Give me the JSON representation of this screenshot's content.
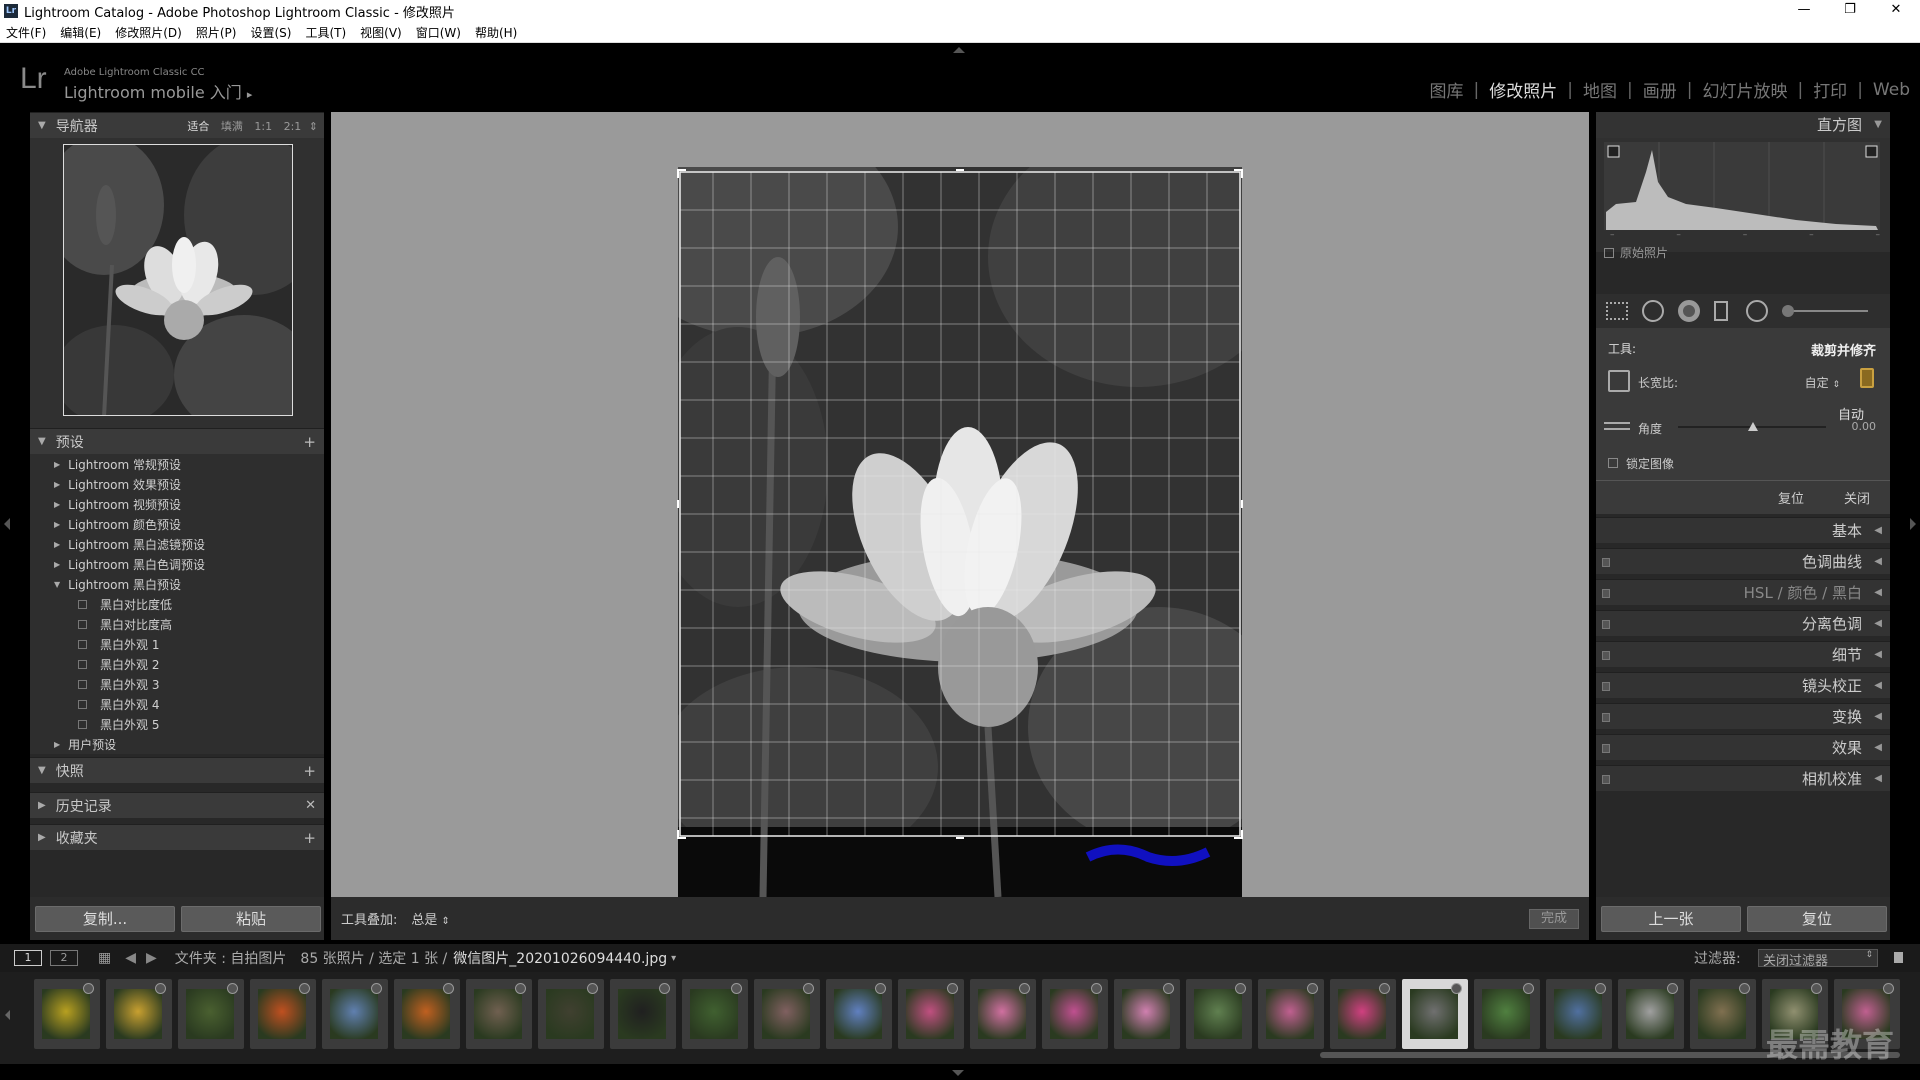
{
  "window": {
    "title": "Lightroom Catalog - Adobe Photoshop Lightroom Classic - 修改照片",
    "badge": "Lr",
    "minimize": "—",
    "maximize": "❐",
    "close": "✕"
  },
  "menu": [
    "文件(F)",
    "编辑(E)",
    "修改照片(D)",
    "照片(P)",
    "设置(S)",
    "工具(T)",
    "视图(V)",
    "窗口(W)",
    "帮助(H)"
  ],
  "identity": {
    "logo": "Lr",
    "product": "Adobe Lightroom Classic CC",
    "mobile": "Lightroom mobile 入门",
    "mobile_arrow": "▸"
  },
  "modules": [
    "图库",
    "修改照片",
    "地图",
    "画册",
    "幻灯片放映",
    "打印",
    "Web"
  ],
  "modules_sep": "|",
  "active_module": "修改照片",
  "navigator": {
    "title": "导航器",
    "options": [
      "适合",
      "填满",
      "1:1",
      "2:1"
    ],
    "options_arrow": "⇕",
    "selected_option": "适合"
  },
  "presets": {
    "title": "预设",
    "items": [
      {
        "label": "Lightroom 常规预设",
        "level": 0,
        "expanded": false
      },
      {
        "label": "Lightroom 效果预设",
        "level": 0,
        "expanded": false
      },
      {
        "label": "Lightroom 视频预设",
        "level": 0,
        "expanded": false
      },
      {
        "label": "Lightroom 颜色预设",
        "level": 0,
        "expanded": false
      },
      {
        "label": "Lightroom 黑白滤镜预设",
        "level": 0,
        "expanded": false
      },
      {
        "label": "Lightroom 黑白色调预设",
        "level": 0,
        "expanded": false
      },
      {
        "label": "Lightroom 黑白预设",
        "level": 0,
        "expanded": true
      },
      {
        "label": "黑白对比度低",
        "level": 1
      },
      {
        "label": "黑白对比度高",
        "level": 1
      },
      {
        "label": "黑白外观 1",
        "level": 1
      },
      {
        "label": "黑白外观 2",
        "level": 1
      },
      {
        "label": "黑白外观 3",
        "level": 1
      },
      {
        "label": "黑白外观 4",
        "level": 1
      },
      {
        "label": "黑白外观 5",
        "level": 1
      },
      {
        "label": "用户预设",
        "level": 0,
        "expanded": false
      }
    ]
  },
  "snapshots": {
    "title": "快照"
  },
  "history": {
    "title": "历史记录"
  },
  "collections": {
    "title": "收藏夹"
  },
  "left_buttons": {
    "copy": "复制...",
    "paste": "粘贴"
  },
  "toolbar": {
    "overlay_label": "工具叠加:",
    "overlay_value": "总是",
    "overlay_arrow": "⇕",
    "done": "完成"
  },
  "histogram": {
    "title": "直方图",
    "original_photo": "原始照片",
    "ticks": [
      "–",
      "–",
      "–",
      "–",
      "–"
    ]
  },
  "crop": {
    "tool_label": "工具:",
    "tool_name": "裁剪并修齐",
    "aspect_label": "长宽比:",
    "aspect_value": "自定",
    "aspect_arrow": "⇕",
    "auto": "自动",
    "angle_label": "角度",
    "angle_value": "0.00",
    "constrain": "锁定图像",
    "reset": "复位",
    "close": "关闭"
  },
  "right_sections": [
    {
      "label": "基本",
      "switch": false
    },
    {
      "label": "色调曲线",
      "switch": true
    },
    {
      "label": "HSL / 颜色 / 黑白",
      "switch": true
    },
    {
      "label": "分离色调",
      "switch": true
    },
    {
      "label": "细节",
      "switch": true
    },
    {
      "label": "镜头校正",
      "switch": true
    },
    {
      "label": "变换",
      "switch": true
    },
    {
      "label": "效果",
      "switch": true
    },
    {
      "label": "相机校准",
      "switch": true
    }
  ],
  "right_buttons": {
    "previous": "上一张",
    "reset": "复位"
  },
  "filmbar": {
    "view1": "1",
    "view2": "2",
    "source": "文件夹 : 自拍图片",
    "count": "85 张照片 / 选定 1 张 /",
    "filename": "微信图片_20201026094440.jpg",
    "filename_arrow": "▾",
    "filter_label": "过滤器:",
    "filter_value": "关闭过滤器",
    "filter_arrow": "⇕"
  },
  "filmstrip": {
    "thumb_colors": [
      "#b8a020",
      "#c8a030",
      "#4a6030",
      "#c05020",
      "#6080b0",
      "#c06020",
      "#706050",
      "#404030",
      "#202020",
      "#406030",
      "#806060",
      "#6080c0",
      "#c05080",
      "#d070a0",
      "#c05090",
      "#d080b0",
      "#608050",
      "#c06090",
      "#d04080",
      "#707070",
      "#508040",
      "#5070a0",
      "#a0a0a0",
      "#807050",
      "#909070",
      "#c06090"
    ],
    "selected_index": 19
  },
  "watermark": "最需教育",
  "colors": {
    "accent": "#ffffff",
    "panel": "#282828",
    "canvas": "#9a9a9a"
  }
}
